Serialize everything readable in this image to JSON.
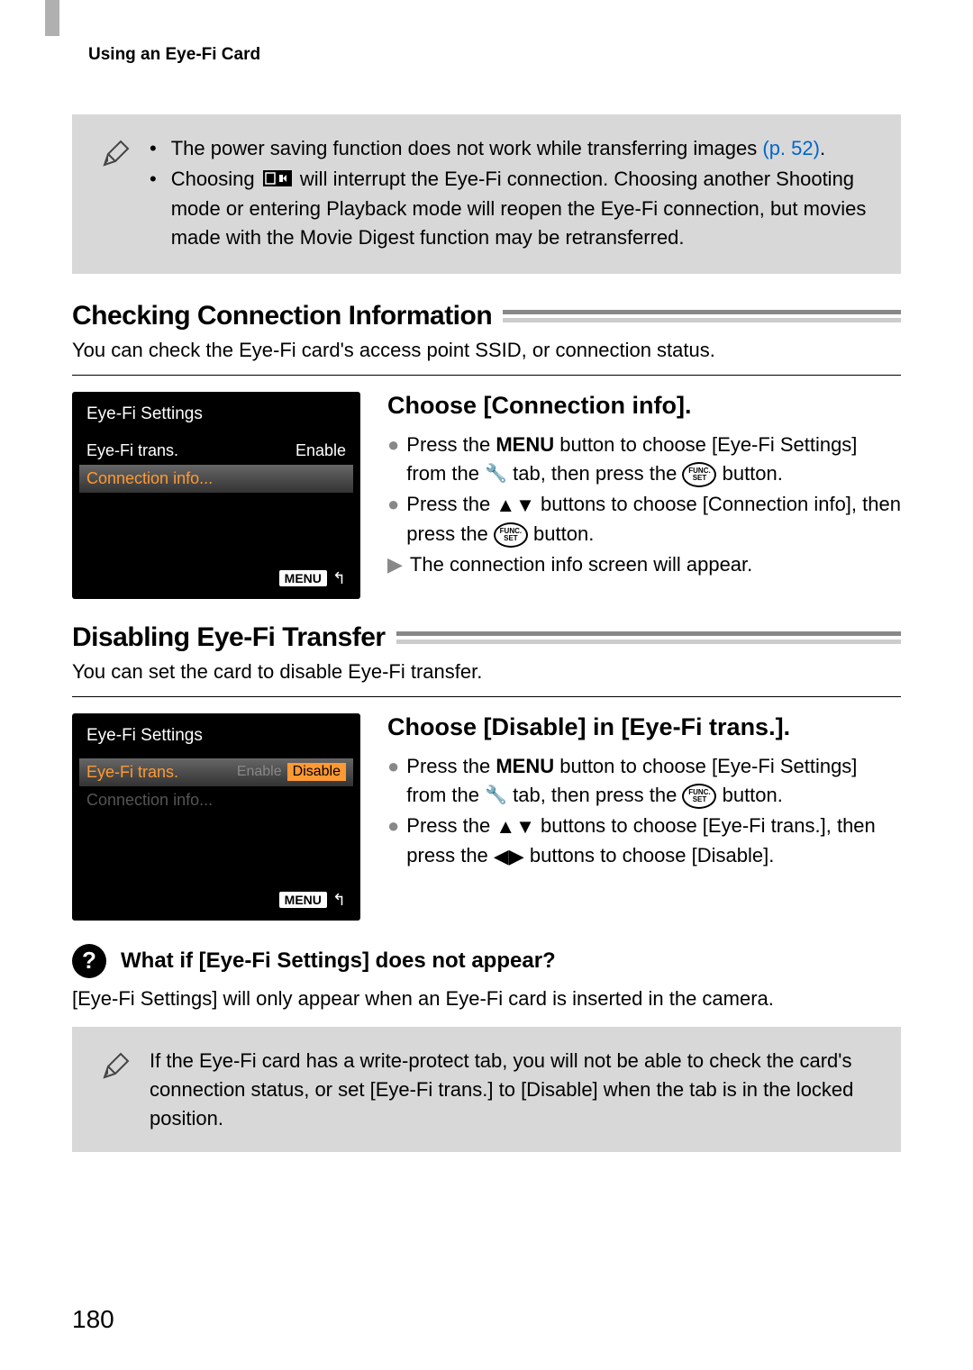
{
  "running_header": "Using an Eye-Fi Card",
  "note1": {
    "bullet1_a": "The power saving function does not work while transferring images ",
    "bullet1_link": "(p. 52)",
    "bullet1_b": ".",
    "bullet2": "Choosing",
    "bullet2_rest": " will interrupt the Eye-Fi connection. Choosing another Shooting mode or entering Playback mode will reopen the Eye-Fi connection, but movies made with the Movie Digest function may be retransferred."
  },
  "section1": {
    "heading": "Checking Connection Information",
    "intro": "You can check the Eye-Fi card's access point SSID, or connection status.",
    "lcd": {
      "title": "Eye-Fi Settings",
      "row1_label": "Eye-Fi trans.",
      "row1_value": "Enable",
      "row2_label": "Connection info...",
      "menu": "MENU"
    },
    "proc_heading": "Choose [Connection info].",
    "step1_a": "Press the ",
    "step1_menu": "MENU",
    "step1_b": " button to choose [Eye-Fi Settings] from the ",
    "step1_c": " tab, then press the ",
    "step1_d": " button.",
    "step2_a": "Press the ",
    "step2_b": " buttons to choose [Connection info], then press the ",
    "step2_c": " button.",
    "result": "The connection info screen will appear."
  },
  "section2": {
    "heading": "Disabling Eye-Fi Transfer",
    "intro": "You can set the card to disable Eye-Fi transfer.",
    "lcd": {
      "title": "Eye-Fi Settings",
      "row1_label": "Eye-Fi trans.",
      "row1_enable": "Enable",
      "row1_disable": "Disable",
      "row2_label": "Connection info...",
      "menu": "MENU"
    },
    "proc_heading": "Choose [Disable] in [Eye-Fi trans.].",
    "step1_a": "Press the ",
    "step1_menu": "MENU",
    "step1_b": " button to choose [Eye-Fi Settings] from the ",
    "step1_c": " tab, then press the ",
    "step1_d": " button.",
    "step2_a": "Press the ",
    "step2_b": " buttons to choose [Eye-Fi trans.], then press the ",
    "step2_c": " buttons to choose [Disable]."
  },
  "question": {
    "title": "What if [Eye-Fi Settings] does not appear?",
    "answer": "[Eye-Fi Settings] will only appear when an Eye-Fi card is inserted in the camera."
  },
  "note2": {
    "text": "If the Eye-Fi card has a write-protect tab, you will not be able to check the card's connection status, or set [Eye-Fi trans.] to [Disable] when the tab is in the locked position."
  },
  "page_number": "180"
}
